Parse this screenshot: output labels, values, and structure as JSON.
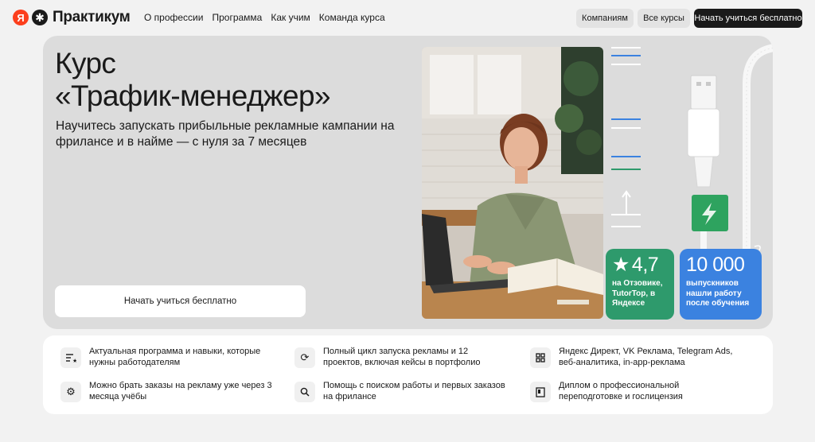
{
  "header": {
    "logo_ya": "Я",
    "logo_text": "Практикум",
    "nav": [
      "О профессии",
      "Программа",
      "Как учим",
      "Команда курса"
    ],
    "btn_companies": "Компаниям",
    "btn_all_courses": "Все курсы",
    "btn_start": "Начать учиться бесплатно"
  },
  "hero": {
    "title_line1": "Курс",
    "title_line2": "«Трафик-менеджер»",
    "subtitle": "Научитесь запускать прибыльные рекламные кампании на фрилансе и в найме — с нуля за 7 месяцев",
    "cta": "Начать учиться бесплатно"
  },
  "cards": {
    "rating_value": "4,7",
    "rating_text": "на Отзовике, TutorTop, в Яндексе",
    "grads_value": "10 000",
    "grads_text": "выпускников нашли работу после обучения"
  },
  "features": [
    {
      "icon": "list-star-icon",
      "text": "Актуальная программа и навыки, которые нужны работодателям"
    },
    {
      "icon": "refresh-icon",
      "text": "Полный цикл запуска рекламы и 12 проектов, включая кейсы в портфолио"
    },
    {
      "icon": "grid-icon",
      "text": "Яндекс Директ, VK Реклама, Telegram Ads, веб-аналитика, in-app-реклама"
    },
    {
      "icon": "gear-icon",
      "text": "Можно брать заказы на рекламу уже через 3 месяца учёбы"
    },
    {
      "icon": "search-icon",
      "text": "Помощь с поиском работы и первых заказов на фрилансе"
    },
    {
      "icon": "diploma-icon",
      "text": "Диплом о профессиональной переподготовке и гослицензия"
    }
  ],
  "colors": {
    "accent_green": "#2e9a6c",
    "accent_blue": "#3b82e0",
    "logo_red": "#fc3f1d"
  }
}
